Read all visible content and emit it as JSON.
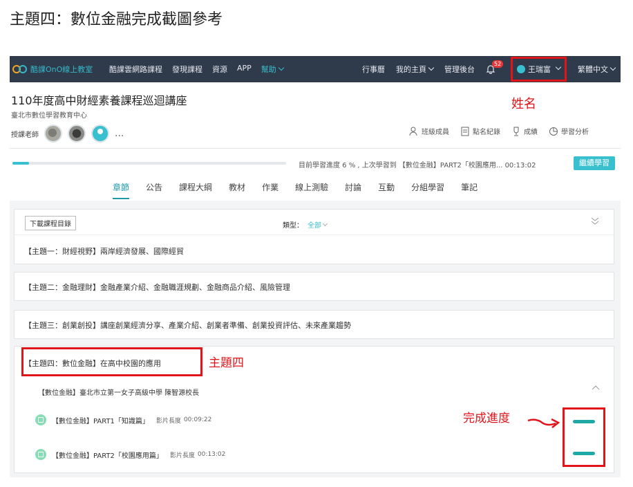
{
  "doc_title": "主題四：數位金融完成截圖參考",
  "navbar": {
    "logo_text": "酷課OnO線上教室",
    "left_items": [
      "酷課雲網路課程",
      "發現課程",
      "資源",
      "APP"
    ],
    "help": "幫助",
    "right_items": [
      "行事曆",
      "我的主頁",
      "管理後台"
    ],
    "notifications": "52",
    "user_name": "王瑞富",
    "language": "繁體中文",
    "bg_color": "#2f3a4b",
    "accent_color": "#38c0ce"
  },
  "course": {
    "title": "110年度高中財經素養課程巡迴講座",
    "org": "臺北市數位學習教育中心",
    "teachers_label": "授課老師",
    "more": "..."
  },
  "tools": [
    "班級成員",
    "點名紀錄",
    "成績",
    "學習分析"
  ],
  "progress": {
    "percent": 6,
    "status": "目前學習進度 6 % , 上次學習到 【數位金融】PART2「校園應用... 00:13:02",
    "continue": "繼續學習"
  },
  "tabs": [
    "章節",
    "公告",
    "課程大綱",
    "教材",
    "作業",
    "線上測驗",
    "討論",
    "互動",
    "分組學習",
    "筆記"
  ],
  "toolbar": {
    "download": "下載課程目錄",
    "filter_label": "類型：",
    "filter_value": "全部"
  },
  "topics": [
    "【主題一：財經視野】兩岸經濟發展、國際經貿",
    "【主題二：金融理財】金融產業介紹、金融職涯規劃、金融商品介紹、風險管理",
    "【主題三：創業創投】講座創業經濟分享、產業介紹、創業者準備、創業投資評估、未來產業趨勢",
    "【主題四：數位金融】在高中校園的應用"
  ],
  "subsection": "【數位金融】臺北市立第一女子高級中學 陳智源校長",
  "lessons": [
    {
      "title": "【數位金融】PART1「知識篇」",
      "dur_label": "影片長度",
      "duration": "00:09:22",
      "completion": 1.0
    },
    {
      "title": "【數位金融】PART2「校園應用篇」",
      "dur_label": "影片長度",
      "duration": "00:13:02",
      "completion": 1.0
    }
  ],
  "annotations": {
    "name": "姓名",
    "topic4": "主題四",
    "completion": "完成進度",
    "color": "#e0141a"
  }
}
